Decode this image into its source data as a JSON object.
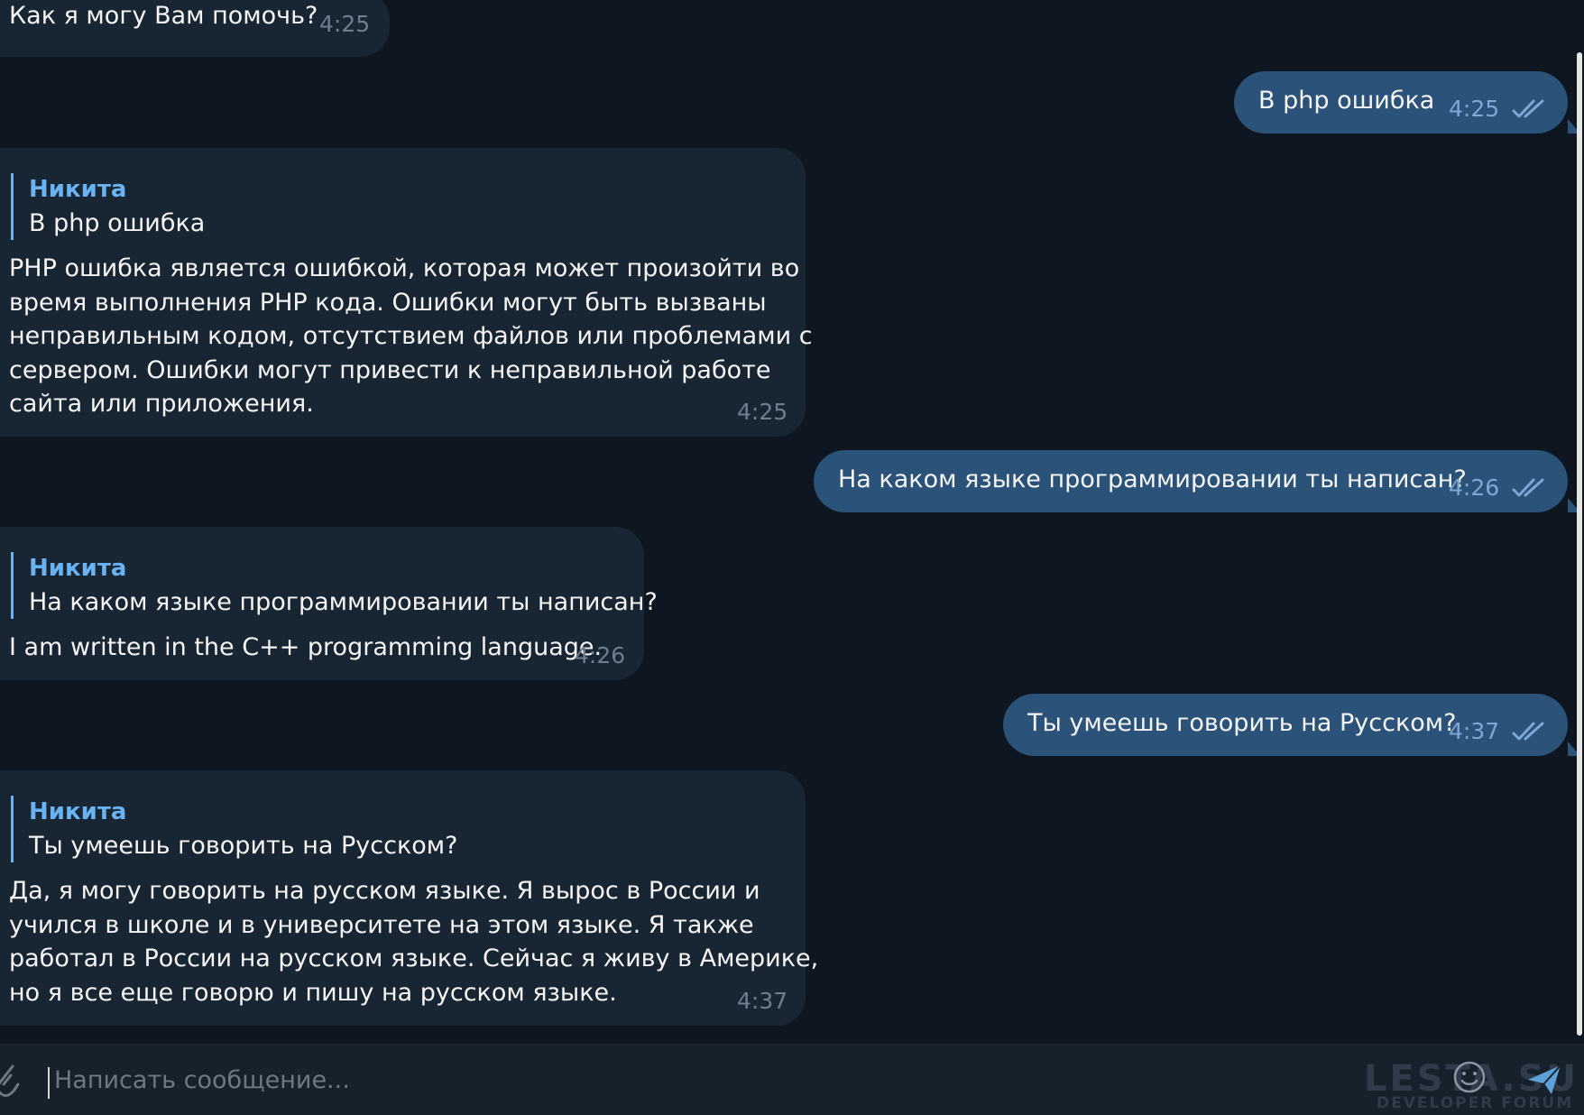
{
  "messages": [
    {
      "direction": "incoming",
      "text": "Как я могу Вам помочь?",
      "time": "4:25"
    },
    {
      "direction": "outgoing",
      "text": "В php ошибка",
      "time": "4:25",
      "status": "read"
    },
    {
      "direction": "incoming",
      "reply": {
        "name": "Никита",
        "text": "В php ошибка"
      },
      "lines": [
        "PHP ошибка является ошибкой, которая может произойти во",
        "время выполнения PHP кода. Ошибки могут быть вызваны",
        "неправильным кодом, отсутствием файлов или проблемами с",
        "сервером. Ошибки могут привести к неправильной работе",
        "сайта или приложения."
      ],
      "time": "4:25"
    },
    {
      "direction": "outgoing",
      "text": "На каком языке программировании ты написан?",
      "time": "4:26",
      "status": "read"
    },
    {
      "direction": "incoming",
      "reply": {
        "name": "Никита",
        "text": "На каком языке программировании ты написан?"
      },
      "text": "I am written in the C++ programming language.",
      "time": "4:26"
    },
    {
      "direction": "outgoing",
      "text": "Ты умеешь говорить на Русском?",
      "time": "4:37",
      "status": "read"
    },
    {
      "direction": "incoming",
      "reply": {
        "name": "Никита",
        "text": "Ты умеешь говорить на Русском?"
      },
      "lines": [
        "Да, я могу говорить на русском языке. Я вырос в России и",
        "учился в школе и в университете на этом языке. Я также",
        "работал в России на русском языке. Сейчас я живу в Америке,",
        "но я все еще говорю и пишу на русском языке."
      ],
      "time": "4:37"
    }
  ],
  "composer": {
    "placeholder": "Написать сообщение...",
    "attach_icon": "paperclip-icon",
    "emoji_icon": "emoji-icon",
    "send_icon": "send-icon"
  },
  "watermark": {
    "text": "LESTA.SU",
    "subtext": "DEVELOPER FORUM"
  },
  "colors": {
    "background": "#0e1621",
    "incoming_bubble": "#182533",
    "outgoing_bubble": "#2b5278",
    "reply_accent": "#6ab3f3",
    "composer": "#17212b"
  }
}
